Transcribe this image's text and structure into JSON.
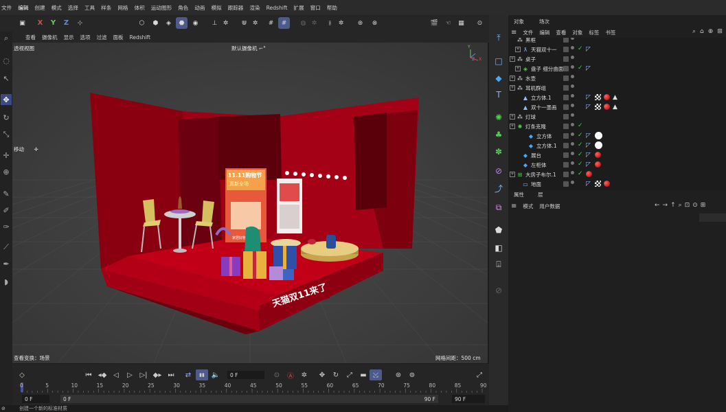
{
  "menubar": {
    "items": [
      "文件",
      "编辑",
      "创建",
      "模式",
      "选择",
      "工具",
      "样条",
      "网格",
      "体积",
      "运动图形",
      "角色",
      "动画",
      "模拟",
      "跟踪器",
      "渲染",
      "Redshift",
      "扩展",
      "窗口",
      "帮助"
    ],
    "active_index": 1
  },
  "toolbar": {
    "axis_x": "X",
    "axis_y": "Y",
    "axis_z": "Z"
  },
  "viewport": {
    "menu": [
      "查看",
      "摄像机",
      "显示",
      "选项",
      "过滤",
      "面板",
      "Redshift"
    ],
    "view_name": "透视视图",
    "camera": "默认摄像机",
    "camera_icon": "⌐°",
    "move_label": "移动",
    "view_transform": "查看变换：场景",
    "grid_spacing": "网格间距：500 cm",
    "axis_labels": [
      "Y",
      "X",
      "Z"
    ],
    "scene": {
      "wall_text": "天猫双11来了",
      "poster_title": "11.11购物节",
      "poster_sub": "真新全场",
      "poster_note": "家居好物"
    }
  },
  "object_panel": {
    "tabs": [
      "对象",
      "场次"
    ],
    "menu": [
      "文件",
      "编辑",
      "查看",
      "对象",
      "标签",
      "书签"
    ],
    "rows": [
      {
        "name": "黑框",
        "icon": "null",
        "expand": false,
        "check": false
      },
      {
        "name": "天猫双十一",
        "icon": "spline",
        "expand": true,
        "check": true
      },
      {
        "name": "桌子",
        "icon": "null",
        "expand": true,
        "check": false
      },
      {
        "name": "盘子 细分曲面",
        "icon": "subdiv",
        "expand": true,
        "check": true
      },
      {
        "name": "水壶",
        "icon": "null",
        "expand": true,
        "check": false
      },
      {
        "name": "耳机群组",
        "icon": "null",
        "expand": true,
        "check": false
      },
      {
        "name": "立方体.1",
        "icon": "poly",
        "expand": false,
        "check": false
      },
      {
        "name": "双十一墨画",
        "icon": "poly",
        "expand": false,
        "check": false
      },
      {
        "name": "灯球",
        "icon": "null",
        "expand": true,
        "check": false
      },
      {
        "name": "灯条克隆",
        "icon": "cloner",
        "expand": true,
        "check": true
      },
      {
        "name": "立方体",
        "icon": "cube",
        "expand": false,
        "check": true
      },
      {
        "name": "立方体.1",
        "icon": "cube",
        "expand": false,
        "check": true
      },
      {
        "name": "展台",
        "icon": "cube",
        "expand": false,
        "check": true
      },
      {
        "name": "左柜体",
        "icon": "cube",
        "expand": false,
        "check": true
      },
      {
        "name": "大房子布尔.1",
        "icon": "boole",
        "expand": true,
        "check": true
      },
      {
        "name": "地面",
        "icon": "floor",
        "expand": false,
        "check": false
      }
    ]
  },
  "attributes_panel": {
    "tabs": [
      "属性",
      "层"
    ],
    "menu": [
      "模式",
      "用户数据"
    ]
  },
  "timeline": {
    "current_frame": "0 F",
    "ruler_labels": [
      "0",
      "5",
      "10",
      "15",
      "20",
      "25",
      "30",
      "35",
      "40",
      "45",
      "50",
      "55",
      "60",
      "65",
      "70",
      "75",
      "80",
      "85",
      "90"
    ],
    "start_field": "0 F",
    "min_field": "0 F",
    "end_field": "90 F",
    "max_field": "90 F"
  },
  "status": {
    "text": "创建一个新的标准材质"
  },
  "colors": {
    "accent": "#4e5a8c",
    "booth_red": "#b3001a",
    "check_green": "#3fd23f"
  }
}
